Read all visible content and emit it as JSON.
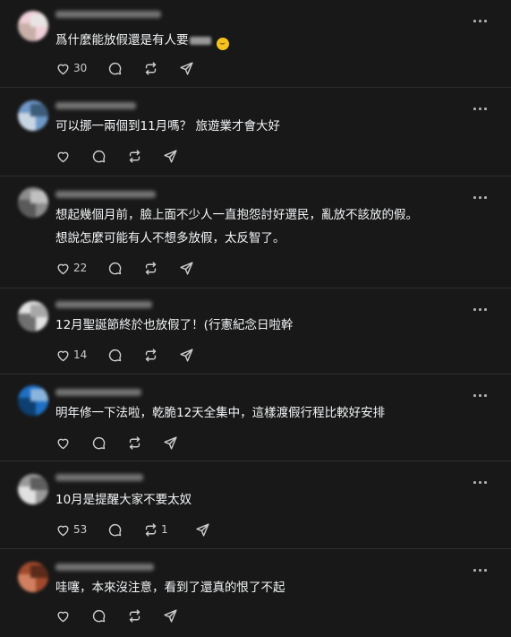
{
  "posts": [
    {
      "text": "爲什麼能放假還是有人要",
      "has_redacted_word": true,
      "has_emoji": true,
      "emoji_icon": "grinning-face-emoji",
      "likes": "30",
      "reposts": "",
      "avatar_colors": [
        "#f1cfd8",
        "#c8b0a8",
        "#e8e4e4"
      ]
    },
    {
      "text": "可以挪一兩個到11月嗎？ 旅遊業才會大好",
      "has_redacted_word": false,
      "has_emoji": false,
      "likes": "",
      "reposts": "",
      "avatar_colors": [
        "#6f98c8",
        "#c8d6e4",
        "#3d5c7a"
      ]
    },
    {
      "text": "想起幾個月前，臉上面不少人一直抱怨討好選民，亂放不該放的假。",
      "text2": "想說怎麼可能有人不想多放假，太反智了。",
      "has_redacted_word": false,
      "has_emoji": false,
      "likes": "22",
      "reposts": "",
      "avatar_colors": [
        "#8c8c8c",
        "#5a5a5a",
        "#c0c0c0"
      ]
    },
    {
      "text": "12月聖誕節終於也放假了！(行憲紀念日啦幹",
      "has_redacted_word": false,
      "has_emoji": false,
      "likes": "14",
      "reposts": "",
      "avatar_colors": [
        "#e2e2e2",
        "#707070",
        "#a8a8a8"
      ]
    },
    {
      "text": "明年修一下法啦，乾脆12天全集中，這樣渡假行程比較好安排",
      "has_redacted_word": false,
      "has_emoji": false,
      "likes": "",
      "reposts": "",
      "avatar_colors": [
        "#1f70c4",
        "#0d3f70",
        "#8ab4dc"
      ]
    },
    {
      "text": "10月是提醒大家不要太奴",
      "has_redacted_word": false,
      "has_emoji": false,
      "likes": "53",
      "reposts": "1",
      "avatar_colors": [
        "#9a9a9a",
        "#e0e0e0",
        "#5e5e5e"
      ]
    },
    {
      "text": "哇噻，本來沒注意，看到了還真的恨了不起",
      "has_redacted_word": false,
      "has_emoji": false,
      "likes": "",
      "reposts": "",
      "avatar_colors": [
        "#a24a2e",
        "#d08060",
        "#5a2a1a"
      ]
    }
  ],
  "icons": {
    "like": "heart-icon",
    "reply": "comment-bubble-icon",
    "repost": "repost-icon",
    "share": "send-icon",
    "more": "more-icon"
  },
  "colors": {
    "background": "#181818",
    "text": "#f3f5f7",
    "icon": "#cccccc",
    "divider": "#2e2e2e"
  }
}
